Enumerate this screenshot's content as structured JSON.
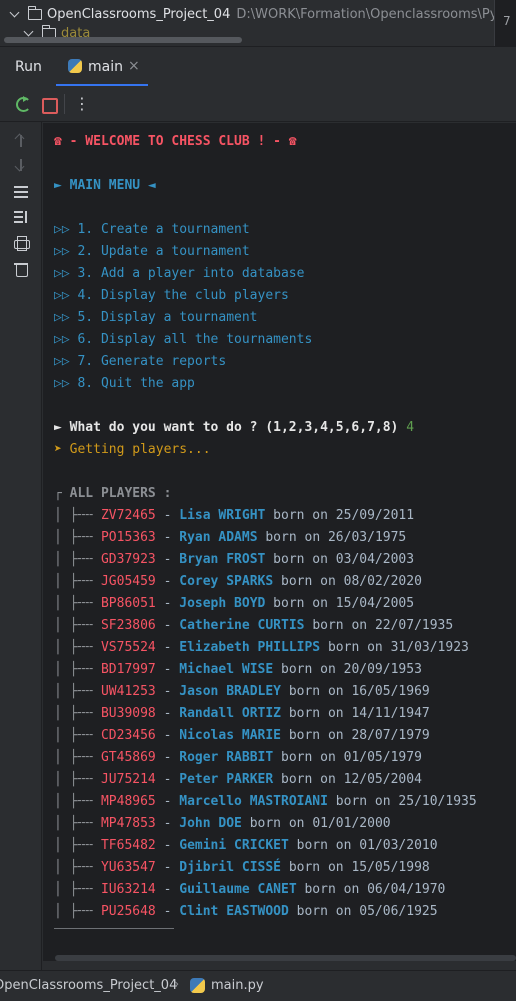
{
  "project_tree": {
    "root_name": "OpenClassrooms_Project_04",
    "root_path": "D:\\WORK\\Formation\\Openclassrooms\\Pyth",
    "child_folder": "data",
    "edge_number": "7"
  },
  "run_panel": {
    "title": "Run",
    "tab_label": "main",
    "tab_close": "×"
  },
  "toolbar": {
    "more_label": "⋮"
  },
  "console": {
    "welcome": "☎ - WELCOME TO CHESS CLUB ! - ☎",
    "main_menu": "► MAIN MENU ◄",
    "menu_prefix": "▷▷",
    "menu_items": [
      "1. Create a tournament",
      "2. Update a tournament",
      "3. Add a player into database",
      "4. Display the club players",
      "5. Display a tournament",
      "6. Display all the tournaments",
      "7. Generate reports",
      "8. Quit the app"
    ],
    "prompt": "► What do you want to do ? (1,2,3,4,5,6,7,8)",
    "answer": "4",
    "getting": "➤ Getting players...",
    "players_header": "┌ ALL PLAYERS :",
    "born_on": "born on",
    "players": [
      {
        "id": "ZV72465",
        "name": "Lisa WRIGHT",
        "date": "25/09/2011"
      },
      {
        "id": "PO15363",
        "name": "Ryan ADAMS",
        "date": "26/03/1975"
      },
      {
        "id": "GD37923",
        "name": "Bryan FROST",
        "date": "03/04/2003"
      },
      {
        "id": "JG05459",
        "name": "Corey SPARKS",
        "date": "08/02/2020"
      },
      {
        "id": "BP86051",
        "name": "Joseph BOYD",
        "date": "15/04/2005"
      },
      {
        "id": "SF23806",
        "name": "Catherine CURTIS",
        "date": "22/07/1935"
      },
      {
        "id": "VS75524",
        "name": "Elizabeth PHILLIPS",
        "date": "31/03/1923"
      },
      {
        "id": "BD17997",
        "name": "Michael WISE",
        "date": "20/09/1953"
      },
      {
        "id": "UW41253",
        "name": "Jason BRADLEY",
        "date": "16/05/1969"
      },
      {
        "id": "BU39098",
        "name": "Randall ORTIZ",
        "date": "14/11/1947"
      },
      {
        "id": "CD23456",
        "name": "Nicolas MARIE",
        "date": "28/07/1979"
      },
      {
        "id": "GT45869",
        "name": "Roger RABBIT",
        "date": "01/05/1979"
      },
      {
        "id": "JU75214",
        "name": "Peter PARKER",
        "date": "12/05/2004"
      },
      {
        "id": "MP48965",
        "name": "Marcello MASTROIANI",
        "date": "25/10/1935"
      },
      {
        "id": "MP47853",
        "name": "John DOE",
        "date": "01/01/2000"
      },
      {
        "id": "TF65482",
        "name": "Gemini CRICKET",
        "date": "01/03/2010"
      },
      {
        "id": "YU63547",
        "name": "Djibril CISSÉ",
        "date": "15/05/1998"
      },
      {
        "id": "IU63214",
        "name": "Guillaume CANET",
        "date": "06/04/1970"
      },
      {
        "id": "PU25648",
        "name": "Clint EASTWOOD",
        "date": "05/06/1925"
      }
    ]
  },
  "status_bar": {
    "project": "OpenClassrooms_Project_04",
    "separator": "›",
    "file": "main.py"
  },
  "colors": {
    "accent_red": "#f75464",
    "accent_blue": "#3592c4",
    "prompt_answer_green": "#5f9e4f",
    "info_yellow": "#d19a1a"
  }
}
